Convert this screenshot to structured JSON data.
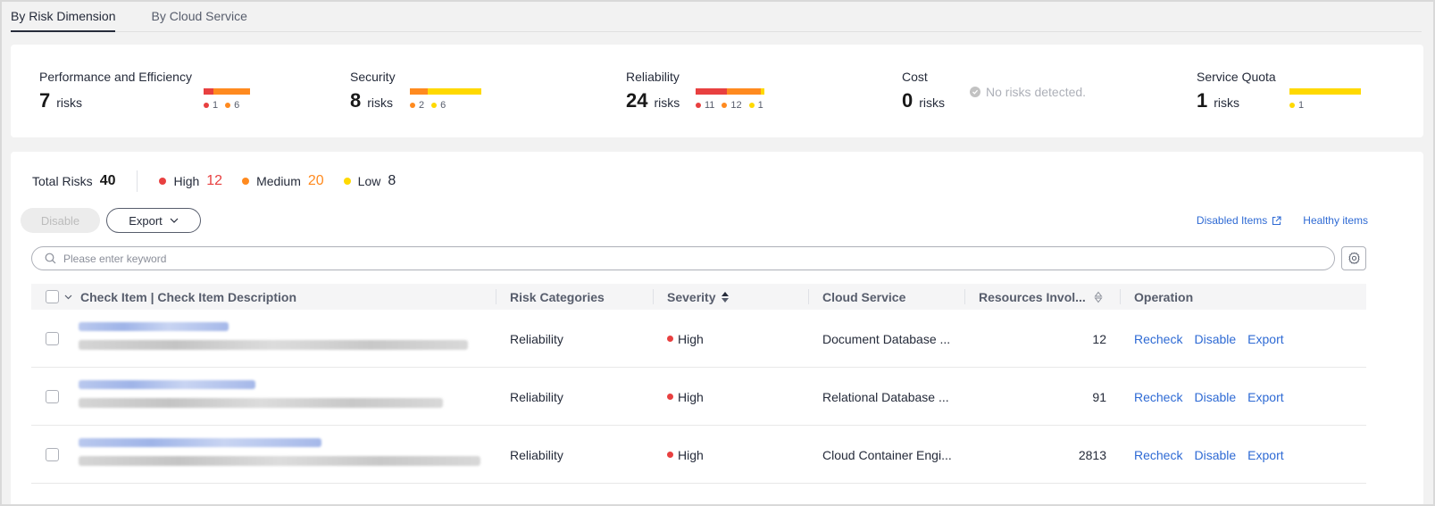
{
  "tabs": [
    {
      "label": "By Risk Dimension",
      "active": true
    },
    {
      "label": "By Cloud Service",
      "active": false
    }
  ],
  "colors": {
    "high": "#e84040",
    "medium": "#ff8a1f",
    "low": "#ffd900",
    "link": "#2e6ad4"
  },
  "dimensions": [
    {
      "name": "Performance and Efficiency",
      "count": "7",
      "unit": "risks",
      "high": "1",
      "medium": "6"
    },
    {
      "name": "Security",
      "count": "8",
      "unit": "risks",
      "medium": "2",
      "low": "6"
    },
    {
      "name": "Reliability",
      "count": "24",
      "unit": "risks",
      "high": "11",
      "medium": "12",
      "low": "1"
    },
    {
      "name": "Cost",
      "count": "0",
      "unit": "risks",
      "no_risk_text": "No risks detected."
    },
    {
      "name": "Service Quota",
      "count": "1",
      "unit": "risks",
      "low": "1"
    }
  ],
  "totals": {
    "total_label": "Total Risks",
    "total_value": "40",
    "high_label": "High",
    "high_value": "12",
    "medium_label": "Medium",
    "medium_value": "20",
    "low_label": "Low",
    "low_value": "8"
  },
  "toolbar": {
    "disable_label": "Disable",
    "export_label": "Export",
    "disabled_items_label": "Disabled Items",
    "healthy_items_label": "Healthy items"
  },
  "search": {
    "placeholder": "Please enter keyword"
  },
  "table": {
    "headers": {
      "check_item": "Check Item | Check Item Description",
      "risk_categories": "Risk Categories",
      "severity": "Severity",
      "cloud_service": "Cloud Service",
      "resources": "Resources Invol...",
      "operation": "Operation"
    },
    "rows": [
      {
        "risk_category": "Reliability",
        "severity": "High",
        "cloud_service": "Document Database ...",
        "resources": "12"
      },
      {
        "risk_category": "Reliability",
        "severity": "High",
        "cloud_service": "Relational Database ...",
        "resources": "91"
      },
      {
        "risk_category": "Reliability",
        "severity": "High",
        "cloud_service": "Cloud Container Engi...",
        "resources": "2813"
      }
    ],
    "operations": {
      "recheck": "Recheck",
      "disable": "Disable",
      "export": "Export"
    }
  }
}
